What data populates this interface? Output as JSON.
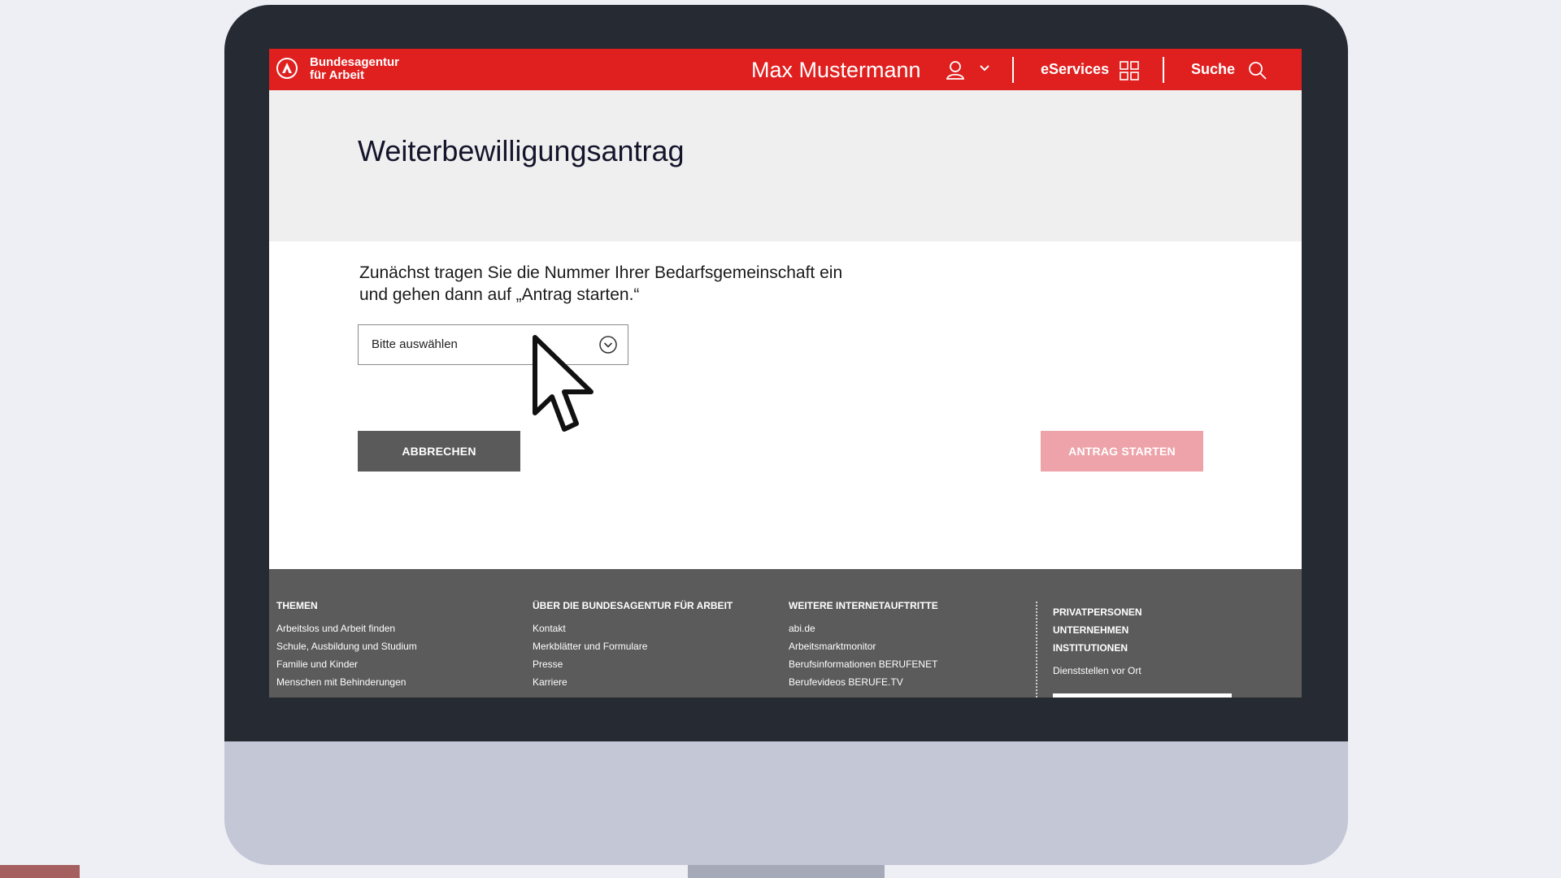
{
  "header": {
    "logo_line1": "Bundesagentur",
    "logo_line2": "für Arbeit",
    "user_name": "Max Mustermann",
    "eservices_label": "eServices",
    "search_label": "Suche"
  },
  "main": {
    "title": "Weiterbewilligungsantrag",
    "instructions_line1": "Zunächst tragen Sie die Nummer Ihrer Bedarfsgemeinschaft ein",
    "instructions_line2": "und gehen dann auf „Antrag starten.“",
    "select_value": "Bitte auswählen",
    "cancel_label": "ABBRECHEN",
    "start_label": "ANTRAG STARTEN"
  },
  "footer": {
    "columns": [
      {
        "heading": "THEMEN",
        "items": [
          "Arbeitslos und Arbeit finden",
          "Schule, Ausbildung und Studium",
          "Familie und Kinder",
          "Menschen mit Behinderungen"
        ]
      },
      {
        "heading": "ÜBER DIE BUNDESAGENTUR FÜR ARBEIT",
        "items": [
          "Kontakt",
          "Merkblätter und Formulare",
          "Presse",
          "Karriere"
        ]
      },
      {
        "heading": "WEITERE INTERNETAUFTRITTE",
        "items": [
          "abi.de",
          "Arbeitsmarktmonitor",
          "Berufsinformationen BERUFENET",
          "Berufevideos BERUFE.TV"
        ]
      }
    ],
    "audience": [
      "PRIVATPERSONEN",
      "UNTERNEHMEN",
      "INSTITUTIONEN"
    ],
    "local_offices": "Dienststellen vor Ort"
  },
  "colors": {
    "brand_red": "#e01f1f",
    "footer_gray": "#5b5b5b",
    "button_gray": "#5a5a5a",
    "button_disabled_pink": "#eda3a9",
    "monitor_bezel": "#262a32"
  },
  "icons": [
    "logo-icon",
    "user-icon",
    "chevron-down-icon",
    "grid-icon",
    "search-icon",
    "select-chevron-icon",
    "mouse-cursor-icon"
  ]
}
